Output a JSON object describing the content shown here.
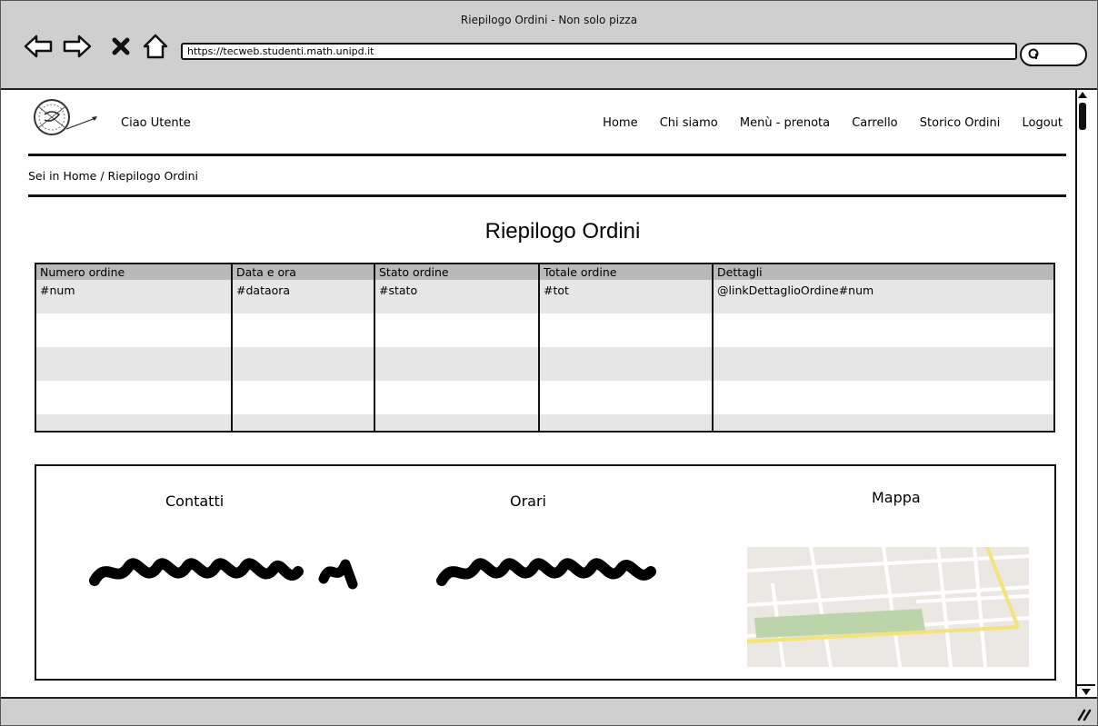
{
  "window": {
    "title": "Riepilogo Ordini - Non solo pizza"
  },
  "browser": {
    "url": "https://tecweb.studenti.math.unipd.it",
    "icons": [
      "back-arrow-icon",
      "forward-arrow-icon",
      "close-icon",
      "home-icon",
      "search-icon"
    ]
  },
  "header": {
    "greeting": "Ciao Utente",
    "nav": [
      "Home",
      "Chi siamo",
      "Menù - prenota",
      "Carrello",
      "Storico Ordini",
      "Logout"
    ]
  },
  "breadcrumb": "Sei in Home / Riepilogo Ordini",
  "main": {
    "title": "Riepilogo Ordini",
    "table": {
      "columns": [
        "Numero ordine",
        "Data e ora",
        "Stato ordine",
        "Totale ordine",
        "Dettagli"
      ],
      "rows": [
        [
          "#num",
          "#dataora",
          "#stato",
          "#tot",
          "@linkDettaglioOrdine#num"
        ],
        [
          "",
          "",
          "",
          "",
          ""
        ],
        [
          "",
          "",
          "",
          "",
          ""
        ],
        [
          "",
          "",
          "",
          "",
          ""
        ],
        [
          "",
          "",
          "",
          "",
          ""
        ]
      ]
    }
  },
  "footer": {
    "contatti_title": "Contatti",
    "orari_title": "Orari",
    "mappa_title": "Mappa"
  },
  "colors": {
    "chrome": "#cfcfcf",
    "table_header": "#b9b9b9",
    "row_alt": "#e6e6e6",
    "map_road": "#f4e27a",
    "map_park": "#bcd4a9"
  }
}
